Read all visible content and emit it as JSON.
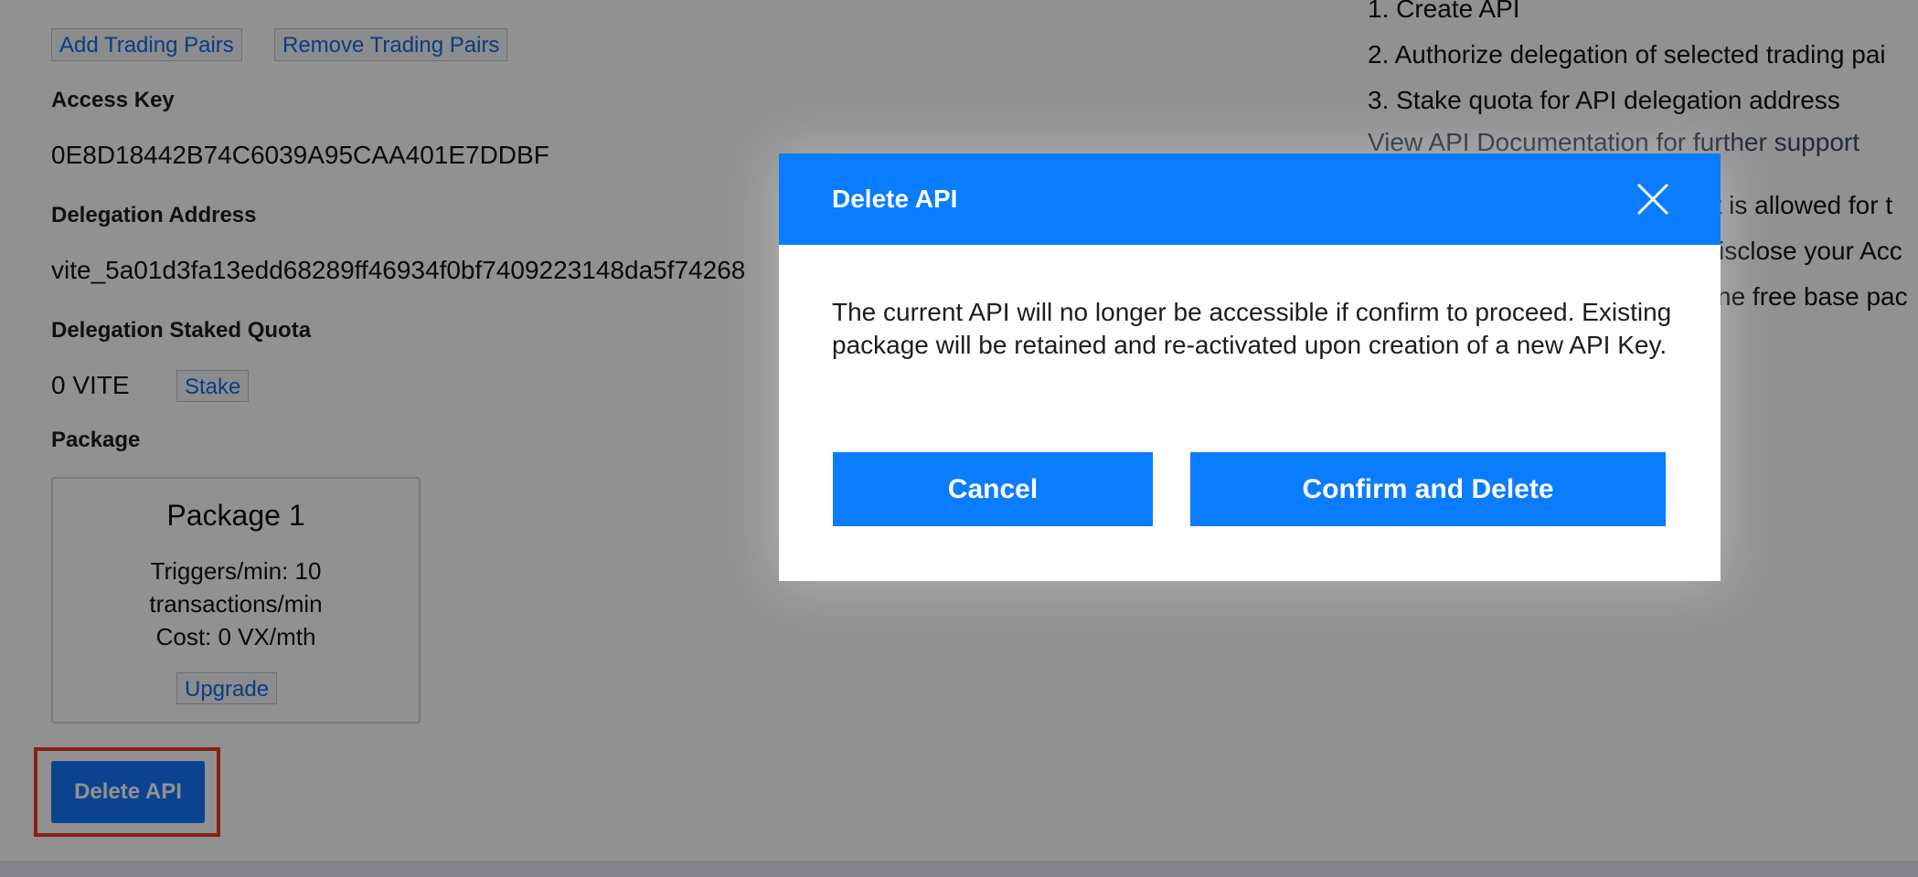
{
  "background": {
    "trading_pairs": {
      "add_label": "Add Trading Pairs",
      "remove_label": "Remove Trading Pairs"
    },
    "access_key": {
      "label": "Access Key",
      "value": "0E8D18442B74C6039A95CAA401E7DDBF"
    },
    "delegation_address": {
      "label": "Delegation Address",
      "value": "vite_5a01d3fa13edd68289ff46934f0bf7409223148da5f74268"
    },
    "staked_quota": {
      "label": "Delegation Staked Quota",
      "value": "0 VITE",
      "stake_label": "Stake"
    },
    "package": {
      "label": "Package",
      "card_title": "Package 1",
      "line1": "Triggers/min: 10",
      "line2": "transactions/min",
      "line3": "Cost: 0 VX/mth",
      "upgrade_label": "Upgrade"
    },
    "delete_api_label": "Delete API",
    "steps": [
      "1. Create API",
      "2. Authorize delegation of selected trading pai",
      "3. Stake quota for API delegation address"
    ],
    "docs_link": "View API Documentation for further support",
    "notes": [
      "et is allowed for t",
      "isclose your Acc",
      "ne free base pac"
    ]
  },
  "modal": {
    "title": "Delete API",
    "message": "The current API will no longer be accessible if confirm to proceed. Existing package will be retained and re-activated upon creation of a new API Key.",
    "cancel_label": "Cancel",
    "confirm_label": "Confirm and Delete"
  },
  "colors": {
    "accent": "#0a7cff",
    "highlight": "#f0391b"
  }
}
